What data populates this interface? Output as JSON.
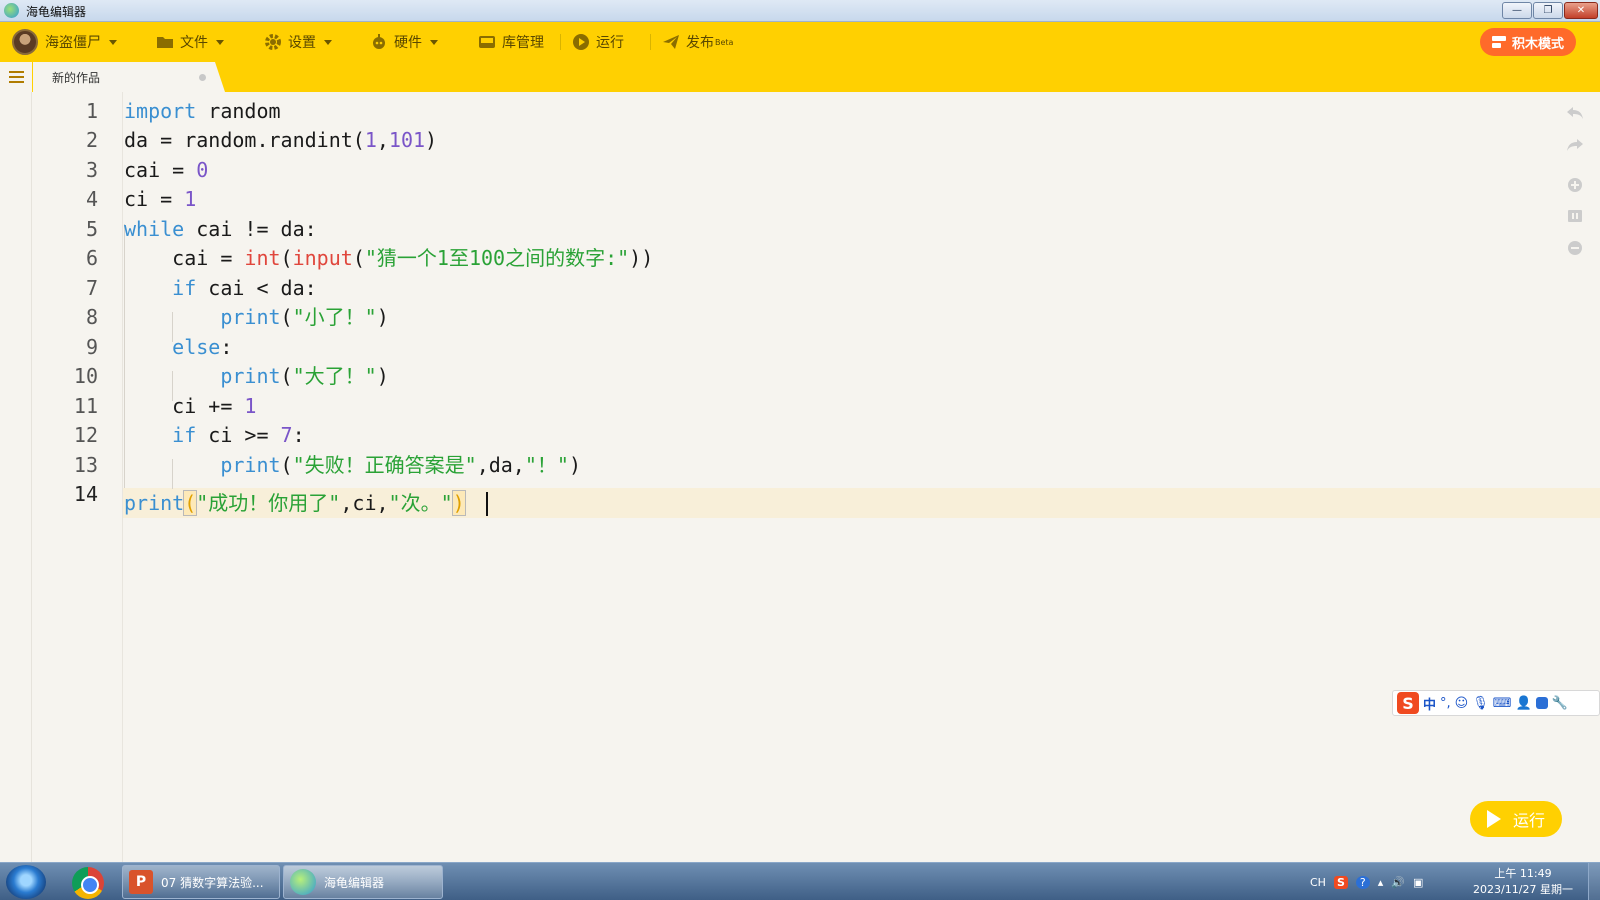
{
  "window": {
    "title": "海龟编辑器"
  },
  "toolbar": {
    "user": "海盗僵尸",
    "file": "文件",
    "settings": "设置",
    "hardware": "硬件",
    "library": "库管理",
    "run": "运行",
    "publish": "发布",
    "publish_badge": "Beta",
    "block_mode": "积木模式"
  },
  "tab": {
    "label": "新的作品"
  },
  "code": {
    "line_numbers": [
      "1",
      "2",
      "3",
      "4",
      "5",
      "6",
      "7",
      "8",
      "9",
      "10",
      "11",
      "12",
      "13",
      "14"
    ],
    "l1_kw": "import",
    "l1_rest": " random",
    "l2_a": "da = random.randint(",
    "l2_n1": "1",
    "l2_c": ",",
    "l2_n2": "101",
    "l2_e": ")",
    "l3_a": "cai = ",
    "l3_n": "0",
    "l4_a": "ci = ",
    "l4_n": "1",
    "l5_kw": "while",
    "l5_rest": " cai != da:",
    "l6_a": "    cai = ",
    "l6_int": "int",
    "l6_p1": "(",
    "l6_input": "input",
    "l6_p2": "(",
    "l6_str": "\"猜一个1至100之间的数字:\"",
    "l6_e": "))",
    "l7_kw": "    if",
    "l7_rest": " cai < da:",
    "l8_fn": "        print",
    "l8_p": "(",
    "l8_str": "\"小了！\"",
    "l8_e": ")",
    "l9_kw": "    else",
    "l9_rest": ":",
    "l10_fn": "        print",
    "l10_p": "(",
    "l10_str": "\"大了！\"",
    "l10_e": ")",
    "l11_a": "    ci += ",
    "l11_n": "1",
    "l12_kw": "    if",
    "l12_rest": " ci >= ",
    "l12_n": "7",
    "l12_e": ":",
    "l13_fn": "        print",
    "l13_p": "(",
    "l13_s1": "\"失败！正确答案是\"",
    "l13_m": ",da,",
    "l13_s2": "\"！\"",
    "l13_e": ")",
    "l14_fn": "print",
    "l14_p": "(",
    "l14_s1": "\"成功！你用了\"",
    "l14_m": ",ci,",
    "l14_s2": "\"次。\"",
    "l14_e": ")"
  },
  "ime": {
    "lang": "中",
    "punct": "°,"
  },
  "run_button": {
    "label": "运行"
  },
  "taskbar": {
    "task_ppt": "07 猜数字算法验...",
    "task_editor": "海龟编辑器",
    "tray_lang": "CH",
    "clock_time": "上午 11:49",
    "clock_date": "2023/11/27 星期一"
  },
  "colors": {
    "toolbar": "#ffd001",
    "keyword": "#3a8fd1",
    "number": "#7a55c8",
    "builtin": "#e0463c",
    "string": "#2aa236",
    "block_mode": "#ff6a2a"
  }
}
